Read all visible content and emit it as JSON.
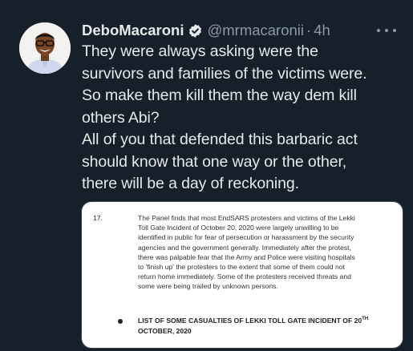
{
  "tweet": {
    "author": {
      "display_name": "DeboMacaroni",
      "handle": "@mrmacaronii",
      "verified": true,
      "avatar_icon": "profile-avatar"
    },
    "separator": "·",
    "time": "4h",
    "more_icon": "more-horizontal-icon",
    "text_lines": [
      "They were always asking were the",
      "survivors and families of the victims were.",
      "So make them kill them the way dem kill",
      "others Abi?",
      "All of you that defended this barbaric act",
      "should know that one way or the other,",
      "there will be a day of reckoning."
    ],
    "media": {
      "paragraph_number": "17.",
      "paragraph_lines": [
        "The Panel finds that most EndSARS protesters and victims of the Lekki",
        "Toll Gate Incident of October 20, 2020 were largely unwilling to be",
        "identified in public for fear of persecution or harassment by the security",
        "agencies and the government generally. Immediately after the protest,",
        "there was palpable fear that the Army and Police were visiting hospitals",
        "to 'finish up' the protesters to the extent that some of them could not",
        "return home immediately. Some of the protesters received threats and",
        "some were being trailed by unknown persons."
      ],
      "bullet_heading_line1": "LIST OF SOME CASUALTIES OF LEKKI TOLL GATE INCIDENT OF 20",
      "bullet_heading_sup": "TH",
      "bullet_heading_line2": "OCTOBER, 2020"
    }
  },
  "colors": {
    "background": "#15202b",
    "primary_text": "#e7e9ea",
    "secondary_text": "#8b98a5",
    "verified_badge": "#1d9bf0"
  }
}
